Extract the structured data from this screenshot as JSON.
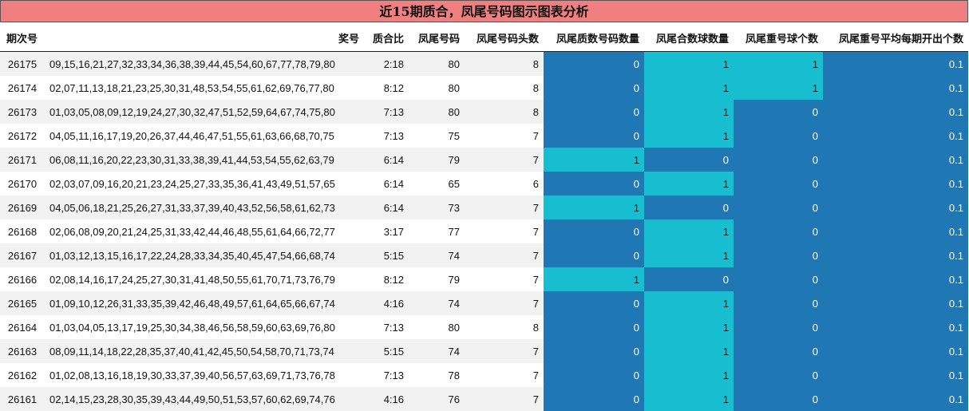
{
  "title": "近15期质合，凤尾号码图示图表分析",
  "headers": [
    "期次号",
    "奖号",
    "质合比",
    "凤尾号码",
    "凤尾号码头数",
    "凤尾质数号码数量",
    "凤尾合数球数量",
    "凤尾重号球个数",
    "凤尾重号平均每期开出个数"
  ],
  "colors": {
    "title_bg": "#f08080",
    "dark_cell": "#1f77b4",
    "light_cell": "#17becf"
  },
  "rows": [
    [
      "26175",
      "09,15,16,21,27,32,33,34,36,38,39,44,45,54,60,67,77,78,79,80",
      "2:18",
      "80",
      "8",
      "0",
      "1",
      "1",
      "0.1"
    ],
    [
      "26174",
      "02,07,11,13,18,21,23,25,30,31,48,53,54,55,61,62,69,76,77,80",
      "8:12",
      "80",
      "8",
      "0",
      "1",
      "1",
      "0.1"
    ],
    [
      "26173",
      "01,03,05,08,09,12,19,24,27,30,32,47,51,52,59,64,67,74,75,80",
      "7:13",
      "80",
      "8",
      "0",
      "1",
      "0",
      "0.1"
    ],
    [
      "26172",
      "04,05,11,16,17,19,20,26,37,44,46,47,51,55,61,63,66,68,70,75",
      "7:13",
      "75",
      "7",
      "0",
      "1",
      "0",
      "0.1"
    ],
    [
      "26171",
      "06,08,11,16,20,22,23,30,31,33,38,39,41,44,53,54,55,62,63,79",
      "6:14",
      "79",
      "7",
      "1",
      "0",
      "0",
      "0.1"
    ],
    [
      "26170",
      "02,03,07,09,16,20,21,23,24,25,27,33,35,36,41,43,49,51,57,65",
      "6:14",
      "65",
      "6",
      "0",
      "1",
      "0",
      "0.1"
    ],
    [
      "26169",
      "04,05,06,18,21,25,26,27,31,33,37,39,40,43,52,56,58,61,62,73",
      "6:14",
      "73",
      "7",
      "1",
      "0",
      "0",
      "0.1"
    ],
    [
      "26168",
      "02,06,08,09,20,21,24,25,31,33,42,44,46,48,55,61,64,66,72,77",
      "3:17",
      "77",
      "7",
      "0",
      "1",
      "0",
      "0.1"
    ],
    [
      "26167",
      "01,03,12,13,15,16,17,22,24,28,33,34,35,40,45,47,54,66,68,74",
      "5:15",
      "74",
      "7",
      "0",
      "1",
      "0",
      "0.1"
    ],
    [
      "26166",
      "02,08,14,16,17,24,25,27,30,31,41,48,50,55,61,70,71,73,76,79",
      "8:12",
      "79",
      "7",
      "1",
      "0",
      "0",
      "0.1"
    ],
    [
      "26165",
      "01,09,10,12,26,31,33,35,39,42,46,48,49,57,61,64,65,66,67,74",
      "4:16",
      "74",
      "7",
      "0",
      "1",
      "0",
      "0.1"
    ],
    [
      "26164",
      "01,03,04,05,13,17,19,25,30,34,38,46,56,58,59,60,63,69,76,80",
      "7:13",
      "80",
      "8",
      "0",
      "1",
      "0",
      "0.1"
    ],
    [
      "26163",
      "08,09,11,14,18,22,28,35,37,40,41,42,45,50,54,58,70,71,73,74",
      "5:15",
      "74",
      "7",
      "0",
      "1",
      "0",
      "0.1"
    ],
    [
      "26162",
      "01,02,08,13,16,18,19,30,33,37,39,40,56,57,63,69,71,73,76,78",
      "7:13",
      "78",
      "7",
      "0",
      "1",
      "0",
      "0.1"
    ],
    [
      "26161",
      "02,14,15,23,28,30,35,39,43,44,49,50,51,53,57,60,62,69,74,76",
      "4:16",
      "76",
      "7",
      "0",
      "1",
      "0",
      "0.1"
    ]
  ]
}
